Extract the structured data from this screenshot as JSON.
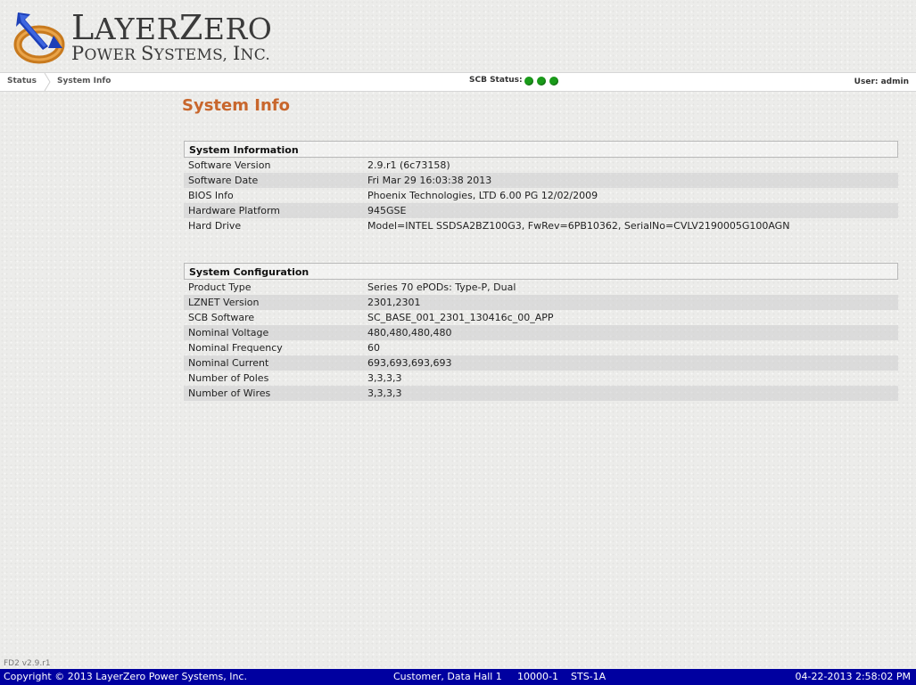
{
  "brand": {
    "line1_first": "L",
    "line1_rest": "AYER",
    "line1_first2": "Z",
    "line1_rest2": "ERO",
    "line2_first": "P",
    "line2_rest": "OWER ",
    "line2_first2": "S",
    "line2_rest2": "YSTEMS, ",
    "line2_first3": "I",
    "line2_rest3": "NC."
  },
  "nav": {
    "crumbs": [
      "Status",
      "System Info"
    ],
    "scb_label": "SCB Status:",
    "scb_indicators": [
      "green",
      "green",
      "green"
    ],
    "user": "User: admin"
  },
  "page_title": "System Info",
  "system_information": {
    "title": "System Information",
    "rows": [
      {
        "key": "Software Version",
        "value": "2.9.r1 (6c73158)"
      },
      {
        "key": "Software Date",
        "value": "Fri Mar 29 16:03:38 2013"
      },
      {
        "key": "BIOS Info",
        "value": "Phoenix Technologies, LTD 6.00 PG 12/02/2009"
      },
      {
        "key": "Hardware Platform",
        "value": "945GSE"
      },
      {
        "key": "Hard Drive",
        "value": "Model=INTEL SSDSA2BZ100G3, FwRev=6PB10362, SerialNo=CVLV2190005G100AGN"
      }
    ]
  },
  "system_configuration": {
    "title": "System Configuration",
    "rows": [
      {
        "key": "Product Type",
        "value": "Series 70 ePODs: Type-P, Dual"
      },
      {
        "key": "LZNET Version",
        "value": "2301,2301"
      },
      {
        "key": "SCB Software",
        "value": "SC_BASE_001_2301_130416c_00_APP"
      },
      {
        "key": "Nominal Voltage",
        "value": "480,480,480,480"
      },
      {
        "key": "Nominal Frequency",
        "value": "60"
      },
      {
        "key": "Nominal Current",
        "value": "693,693,693,693"
      },
      {
        "key": "Number of Poles",
        "value": "3,3,3,3"
      },
      {
        "key": "Number of Wires",
        "value": "3,3,3,3"
      }
    ]
  },
  "version_tag": "FD2 v2.9.r1",
  "footer": {
    "copyright": "Copyright © 2013 LayerZero Power Systems, Inc.",
    "location": "Customer, Data Hall 1",
    "unit_id": "10000-1",
    "unit_type": "STS-1A",
    "datetime": "04-22-2013 2:58:02 PM"
  },
  "colors": {
    "title": "#c8662c",
    "footer_bg": "#0000a0",
    "status_ok": "#1a9b1a",
    "logo_blue": "#1c3fb8",
    "logo_orange": "#c87a1e"
  }
}
